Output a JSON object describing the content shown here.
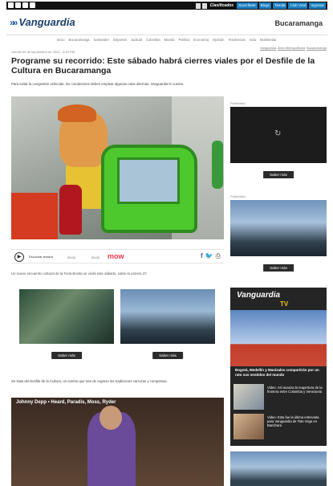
{
  "topbar": {
    "classifieds": "Clasificados",
    "buttons": [
      "Suscríbete",
      "Blogs",
      "Tienda",
      "Club Vnrd",
      "Ingresar"
    ]
  },
  "header": {
    "logo_text": "Vanguardia",
    "city": "Bucaramanga",
    "nav": [
      "Inicio",
      "Bucaramanga",
      "Santander",
      "Deportes",
      "Judicial",
      "Colombia",
      "Mundo",
      "Política",
      "Economía",
      "Opinión",
      "Tendencias",
      "Vida",
      "Multimedia"
    ]
  },
  "article": {
    "date": "viernes 09 de septiembre de 2022 - 3:49 PM",
    "tags": [
      "Vanguardia",
      "Área Metropolitana",
      "Bucaramanga"
    ],
    "title": "Programe su recorrido: Este sábado habrá cierres viales por el Desfile de la Cultura en Bucaramanga",
    "lead": "Para evitar la congestión vehicular, los conductores deben emplear algunas rutas alternas. Vanguardia le cuenta.",
    "caption": "Un nuevo encuentro cultural de la Feria Bonita se vivirá este sábado, sobre la carrera 27.",
    "body": "Se trata del Desfile de la Cultura, un evento que trae de regreso las tradiciones carrozas y comparsas.",
    "video_title": "Johnny Depp • Heard, Paradis, Moss, Ryder"
  },
  "player": {
    "listen_label": "Escuchar lectura",
    "time_start": "00:00",
    "time_end": "00:00",
    "brand": "mow"
  },
  "ads": {
    "button_label": "Saber más",
    "label": "Publicidad"
  },
  "vanguardia_tv": {
    "brand": "Vanguardia",
    "tv": "TV",
    "headline": "Bogotá, Medellín y Manizales compartirán por un rato sus sentidos del mundo",
    "items": [
      "Video: Así avanza la reapertura de la frontera entre Colombia y Venezuela",
      "Video: Esta fue la última entrevista para Vanguardia de Toto Vega en Barichara"
    ]
  }
}
